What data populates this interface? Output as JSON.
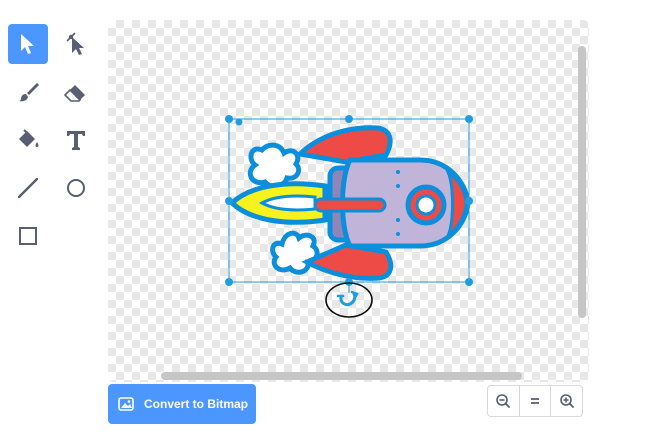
{
  "tools": [
    {
      "id": "select",
      "icon": "arrow-cursor-icon",
      "selected": true
    },
    {
      "id": "reshape",
      "icon": "reshape-cursor-icon",
      "selected": false
    },
    {
      "id": "brush",
      "icon": "brush-icon",
      "selected": false
    },
    {
      "id": "eraser",
      "icon": "eraser-icon",
      "selected": false
    },
    {
      "id": "fill",
      "icon": "paint-bucket-icon",
      "selected": false
    },
    {
      "id": "text",
      "icon": "text-t-icon",
      "selected": false
    },
    {
      "id": "line",
      "icon": "line-icon",
      "selected": false
    },
    {
      "id": "circle",
      "icon": "circle-icon",
      "selected": false
    },
    {
      "id": "rectangle",
      "icon": "rectangle-icon",
      "selected": false
    }
  ],
  "canvas": {
    "sprite": "rocket",
    "selection_color": "#1e9de0",
    "highlighted_handle": "rotate-handle"
  },
  "footer": {
    "convert_label": "Convert to Bitmap",
    "zoom_out_icon": "zoom-out-icon",
    "zoom_reset_icon": "zoom-reset-icon",
    "zoom_in_icon": "zoom-in-icon"
  },
  "colors": {
    "accent": "#4c97ff",
    "rocket_outline": "#0b8fdc",
    "rocket_body": "#c0b5d8",
    "rocket_fins": "#ef4b46",
    "flame": "#f6f21e"
  }
}
